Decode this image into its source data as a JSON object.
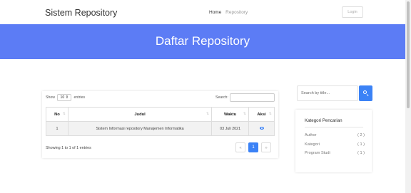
{
  "navbar": {
    "brand": "Sistem Repository",
    "links": [
      {
        "label": "Home"
      },
      {
        "label": "Repository"
      }
    ],
    "login_label": "Login"
  },
  "hero": {
    "title": "Daftar Repository"
  },
  "table_controls": {
    "show_label": "Show",
    "entries_value": "10",
    "entries_label": "entries",
    "search_label": "Search:",
    "search_value": ""
  },
  "table": {
    "columns": [
      "No",
      "Judul",
      "Waktu",
      "Aksi"
    ],
    "rows": [
      {
        "no": "1",
        "judul": "Sistem Informasi repository Manajemen Informatika",
        "waktu": "03 Juli 2021",
        "aksi_icon": "eye-icon"
      }
    ],
    "info": "Showing 1 to 1 of 1 entries"
  },
  "pagination": {
    "prev": "«",
    "current": "1",
    "next": "»",
    "accent": "#3b82f6"
  },
  "sidebar": {
    "search_placeholder": "Search by title...",
    "category_title": "Kategori Pencarian",
    "categories": [
      {
        "label": "Author",
        "count": "( 2 )"
      },
      {
        "label": "Kategori",
        "count": "( 1 )"
      },
      {
        "label": "Program Studi",
        "count": "( 1 )"
      }
    ]
  },
  "colors": {
    "hero_bg": "#5c7cf5",
    "accent": "#3b82f6"
  }
}
